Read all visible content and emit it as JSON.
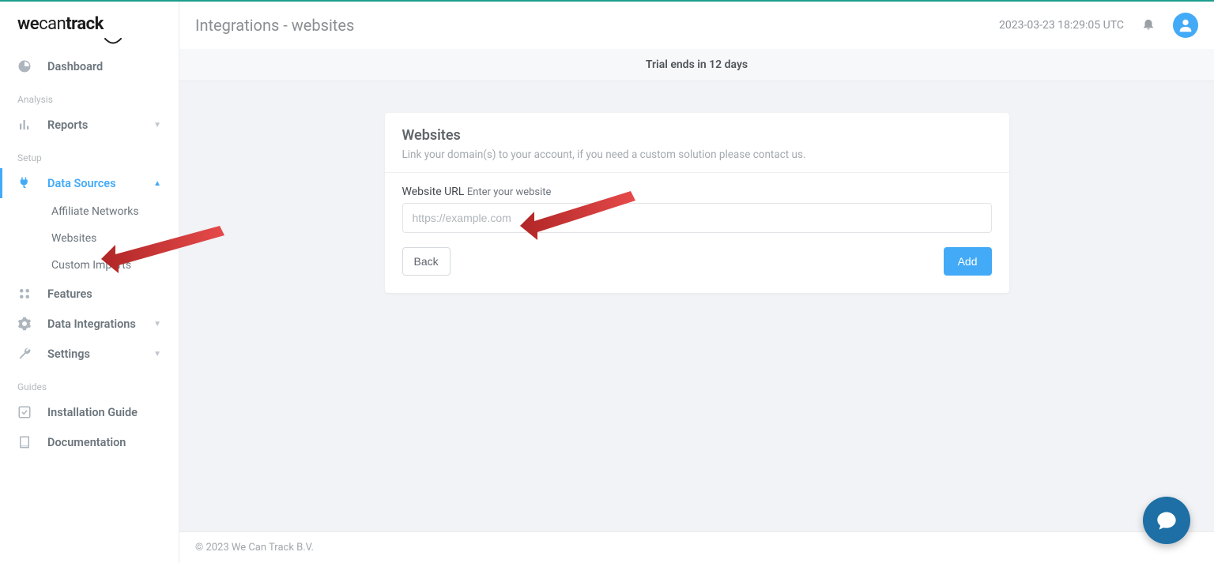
{
  "logo": {
    "we": "we",
    "can": "can",
    "track": "track"
  },
  "header": {
    "title": "Integrations - websites",
    "timestamp": "2023-03-23 18:29:05 UTC"
  },
  "trial_banner": "Trial ends in 12 days",
  "sidebar": {
    "dashboard": "Dashboard",
    "section_analysis": "Analysis",
    "reports": "Reports",
    "section_setup": "Setup",
    "data_sources": "Data Sources",
    "sub_affiliate": "Affiliate Networks",
    "sub_websites": "Websites",
    "sub_custom": "Custom Imports",
    "features": "Features",
    "data_integrations": "Data Integrations",
    "settings": "Settings",
    "section_guides": "Guides",
    "install_guide": "Installation Guide",
    "documentation": "Documentation"
  },
  "card": {
    "title": "Websites",
    "subtitle": "Link your domain(s) to your account, if you need a custom solution please contact us.",
    "label_main": "Website URL",
    "label_hint": "Enter your website",
    "placeholder": "https://example.com",
    "btn_back": "Back",
    "btn_add": "Add"
  },
  "footer": "© 2023 We Can Track B.V."
}
